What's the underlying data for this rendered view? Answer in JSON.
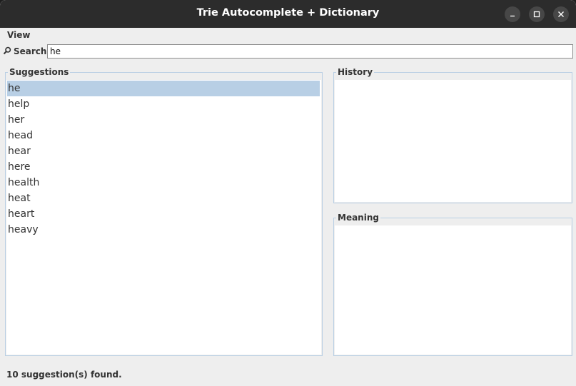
{
  "window": {
    "title": "Trie Autocomplete + Dictionary"
  },
  "menu": {
    "items": [
      "View"
    ]
  },
  "search": {
    "label": "Search:",
    "value": "he"
  },
  "suggestions": {
    "title": "Suggestions",
    "items": [
      "he",
      "help",
      "her",
      "head",
      "hear",
      "here",
      "health",
      "heat",
      "heart",
      "heavy"
    ],
    "selected_index": 0
  },
  "history": {
    "title": "History"
  },
  "meaning": {
    "title": "Meaning"
  },
  "status": {
    "text": "10 suggestion(s) found."
  },
  "colors": {
    "selection": "#b8cfe5",
    "titlebar": "#2c2c2c",
    "panel_border": "#b9cfe4"
  }
}
